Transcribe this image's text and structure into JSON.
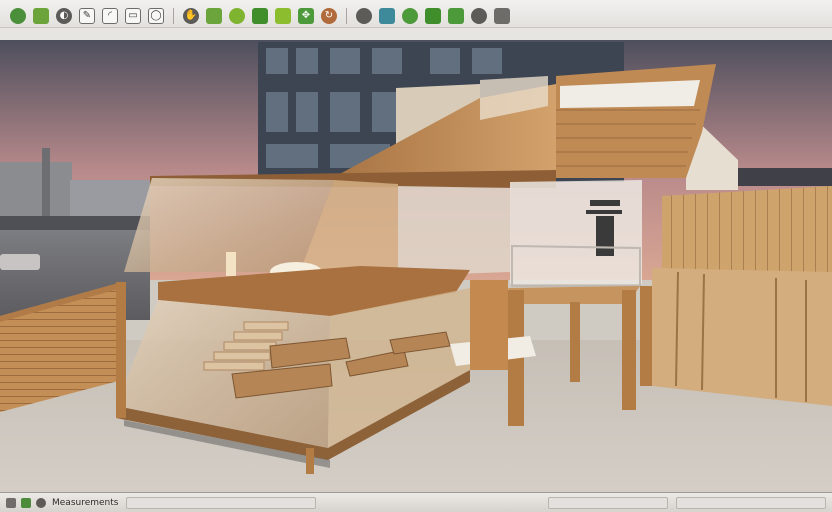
{
  "toolbar": {
    "tools": [
      {
        "name": "select-tool-icon",
        "glyph": "",
        "color": "#4b8f3a",
        "shape": "round"
      },
      {
        "name": "eraser-tool-icon",
        "glyph": "",
        "color": "#6aa43b",
        "shape": "square"
      },
      {
        "name": "orbit-tool-icon",
        "glyph": "◐",
        "color": "#5c5b58",
        "shape": "round"
      },
      {
        "name": "pencil-tool-icon",
        "glyph": "✎",
        "color": "#7c7a76",
        "shape": "outline"
      },
      {
        "name": "arc-tool-icon",
        "glyph": "◜",
        "color": "#7c7a76",
        "shape": "outline"
      },
      {
        "name": "rectangle-tool-icon",
        "glyph": "▭",
        "color": "#7c7a76",
        "shape": "outline"
      },
      {
        "name": "circle-tool-icon",
        "glyph": "◯",
        "color": "#7c7a76",
        "shape": "outline"
      },
      {
        "name": "pan-tool-icon",
        "glyph": "✋",
        "color": "#5c5b58",
        "shape": "round"
      },
      {
        "name": "push-pull-tool-icon",
        "glyph": "",
        "color": "#6aa43b",
        "shape": "square"
      },
      {
        "name": "follow-me-tool-icon",
        "glyph": "",
        "color": "#7fb431",
        "shape": "round"
      },
      {
        "name": "component-tool-icon",
        "glyph": "",
        "color": "#3f8e2b",
        "shape": "square"
      },
      {
        "name": "paint-bucket-tool-icon",
        "glyph": "",
        "color": "#8cbd2e",
        "shape": "square"
      },
      {
        "name": "move-tool-icon",
        "glyph": "✥",
        "color": "#4d9a3a",
        "shape": "square"
      },
      {
        "name": "rotate-tool-icon",
        "glyph": "↻",
        "color": "#b06a3b",
        "shape": "round"
      },
      {
        "name": "tape-measure-tool-icon",
        "glyph": "",
        "color": "#5c5b58",
        "shape": "round"
      },
      {
        "name": "section-plane-tool-icon",
        "glyph": "",
        "color": "#3f8a9a",
        "shape": "square"
      },
      {
        "name": "walk-tool-icon",
        "glyph": "",
        "color": "#4d9a3a",
        "shape": "round"
      },
      {
        "name": "look-around-tool-icon",
        "glyph": "",
        "color": "#3f8e2b",
        "shape": "square"
      },
      {
        "name": "zoom-tool-icon",
        "glyph": "",
        "color": "#4d9a3a",
        "shape": "square"
      },
      {
        "name": "zoom-extents-tool-icon",
        "glyph": "",
        "color": "#5c5b58",
        "shape": "round"
      },
      {
        "name": "camera-tool-icon",
        "glyph": "",
        "color": "#6e6c68",
        "shape": "square"
      }
    ]
  },
  "colors": {
    "sky_top": "#4c4e5c",
    "sky_glow": "#c8908a",
    "wood_light": "#c9955e",
    "wood_dark": "#9b6a3e",
    "glass": "#d8c7ae",
    "ground": "#cbc4bb"
  },
  "status": {
    "text": "Measurements"
  }
}
